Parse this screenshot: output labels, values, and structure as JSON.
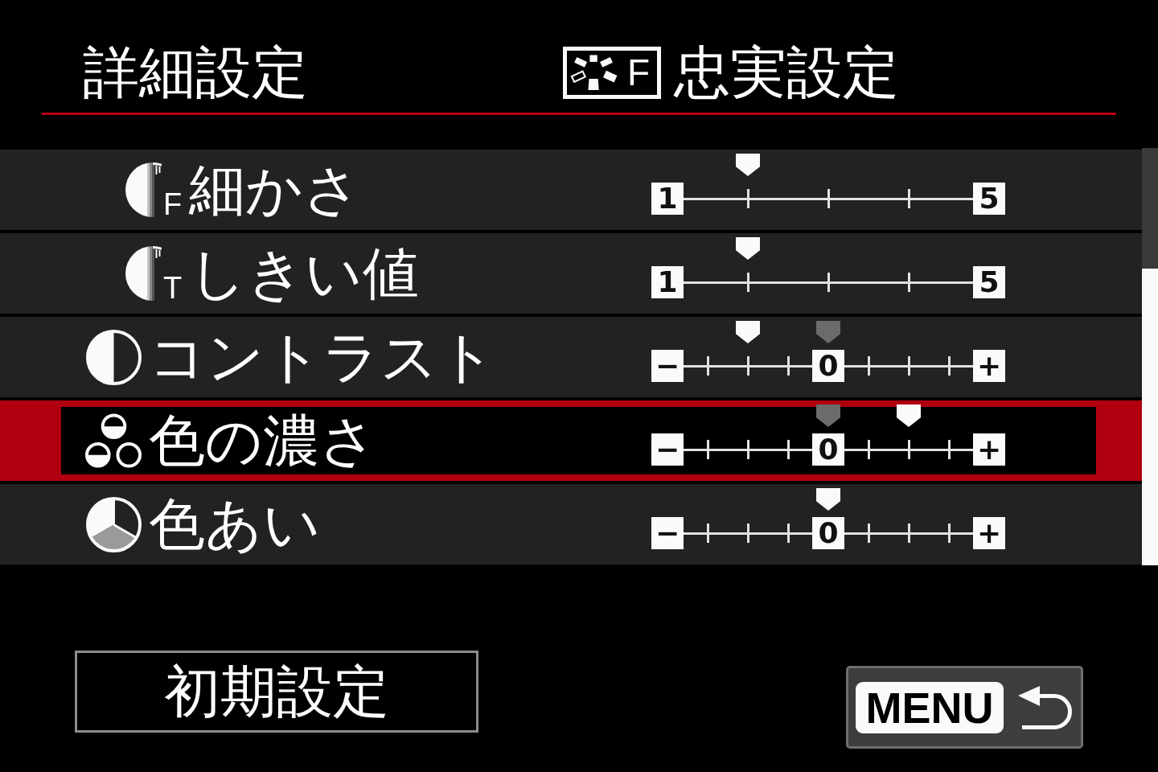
{
  "header": {
    "title": "詳細設定",
    "style_icon_letter": "F",
    "style_name": "忠実設定"
  },
  "settings": [
    {
      "kind": "sub",
      "icon_letter": "F",
      "label": "細かさ",
      "scale": {
        "kind": "unipolar",
        "min_label": "1",
        "max_label": "5"
      },
      "level": 0.25,
      "default_marker": false,
      "selected": false
    },
    {
      "kind": "sub",
      "icon_letter": "T",
      "label": "しきい値",
      "scale": {
        "kind": "unipolar",
        "min_label": "1",
        "max_label": "5"
      },
      "level": 0.25,
      "default_marker": false,
      "selected": false
    },
    {
      "kind": "main",
      "label": "コントラスト",
      "scale": {
        "kind": "bipolar",
        "min_label": "−",
        "center_label": "0",
        "max_label": "+"
      },
      "level": 0.25,
      "default_marker": true,
      "selected": false
    },
    {
      "kind": "main",
      "label": "色の濃さ",
      "scale": {
        "kind": "bipolar",
        "min_label": "−",
        "center_label": "0",
        "max_label": "+"
      },
      "level": 0.75,
      "default_marker": true,
      "selected": true
    },
    {
      "kind": "main",
      "label": "色あい",
      "scale": {
        "kind": "bipolar",
        "min_label": "−",
        "center_label": "0",
        "max_label": "+"
      },
      "level": 0.5,
      "default_marker": false,
      "selected": false
    }
  ],
  "default_button": {
    "label": "初期設定"
  },
  "back_button": {
    "key_label": "MENU"
  }
}
